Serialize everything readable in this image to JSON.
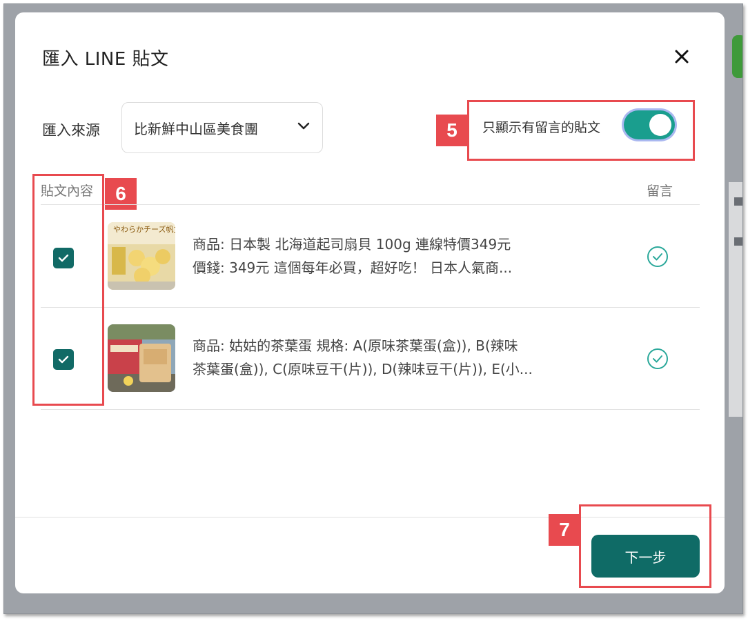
{
  "dialog": {
    "title": "匯入 LINE 貼文",
    "close_icon": "close-icon"
  },
  "source": {
    "label": "匯入來源",
    "selected": "比新鮮中山區美食團"
  },
  "filter": {
    "label": "只顯示有留言的貼文",
    "enabled": true
  },
  "table": {
    "col_content": "貼文內容",
    "col_comment": "留言",
    "rows": [
      {
        "checked": true,
        "line1": "商品: 日本製 北海道起司扇貝 100g 連線特價349元",
        "line2": "價錢: 349元 這個每年必買，超好吃！ 日本人氣商...",
        "thumb_text": "やわらかチーズ帆立",
        "has_comment": true
      },
      {
        "checked": true,
        "line1": "商品: 姑姑的茶葉蛋 規格: A(原味茶葉蛋(盒)), B(辣味",
        "line2": "茶葉蛋(盒)), C(原味豆干(片)), D(辣味豆干(片)), E(小...",
        "has_comment": true
      }
    ]
  },
  "annotations": {
    "badge_5": "5",
    "badge_6": "6",
    "badge_7": "7"
  },
  "footer": {
    "next_label": "下一步"
  },
  "colors": {
    "accent": "#116a66",
    "toggle": "#1a9e8e",
    "annotation": "#e84a4f",
    "check_circle": "#2aa89a"
  }
}
